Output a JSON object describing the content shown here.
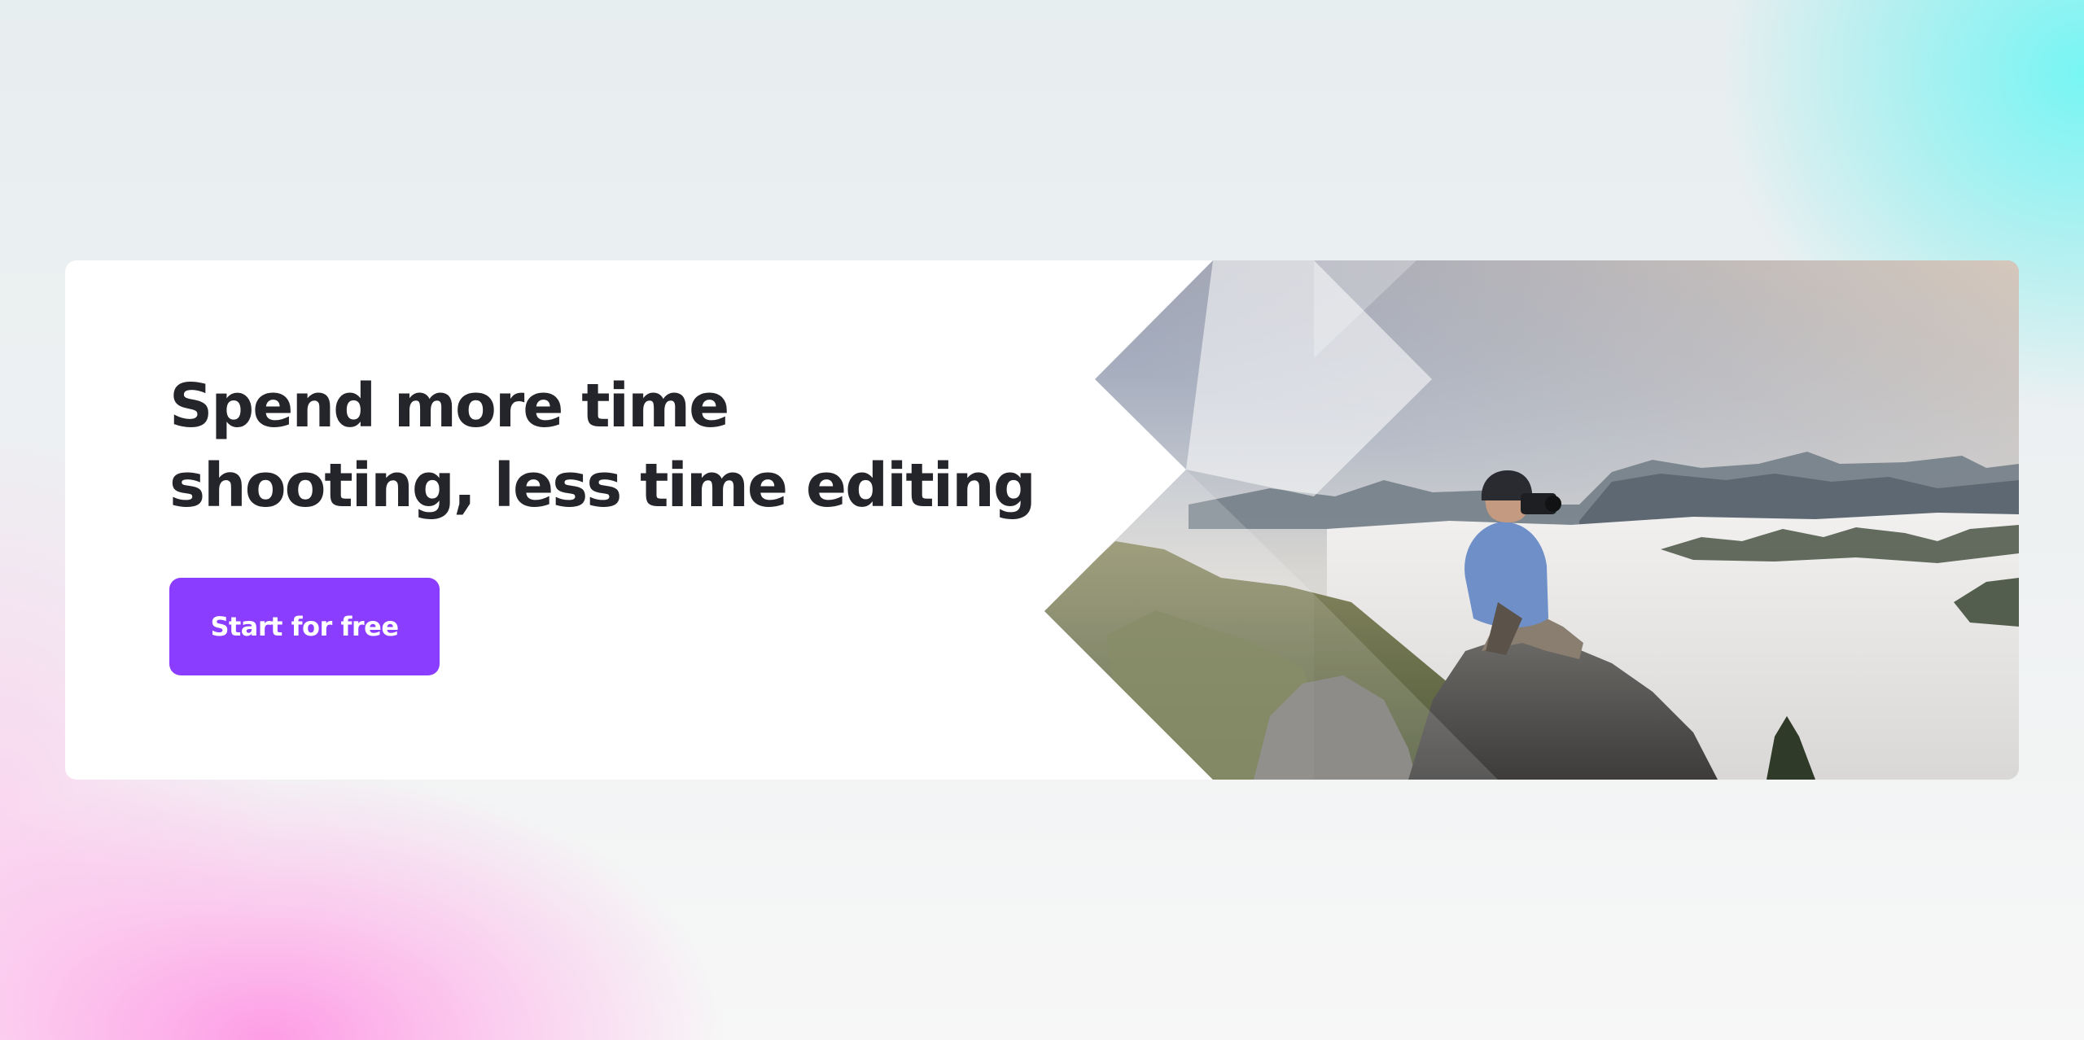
{
  "hero": {
    "headline_line1": "Spend more time",
    "headline_line2": "shooting, less time editing",
    "cta_label": "Start for free"
  },
  "photo": {
    "icon": "landscape-photographer-image",
    "subject": "photographer on mountain summit above sea of clouds"
  },
  "colors": {
    "accent": "#8a3cff",
    "headline": "#24242b",
    "background_cyan": "#70f6f4",
    "background_pink": "#ff8ce2"
  }
}
